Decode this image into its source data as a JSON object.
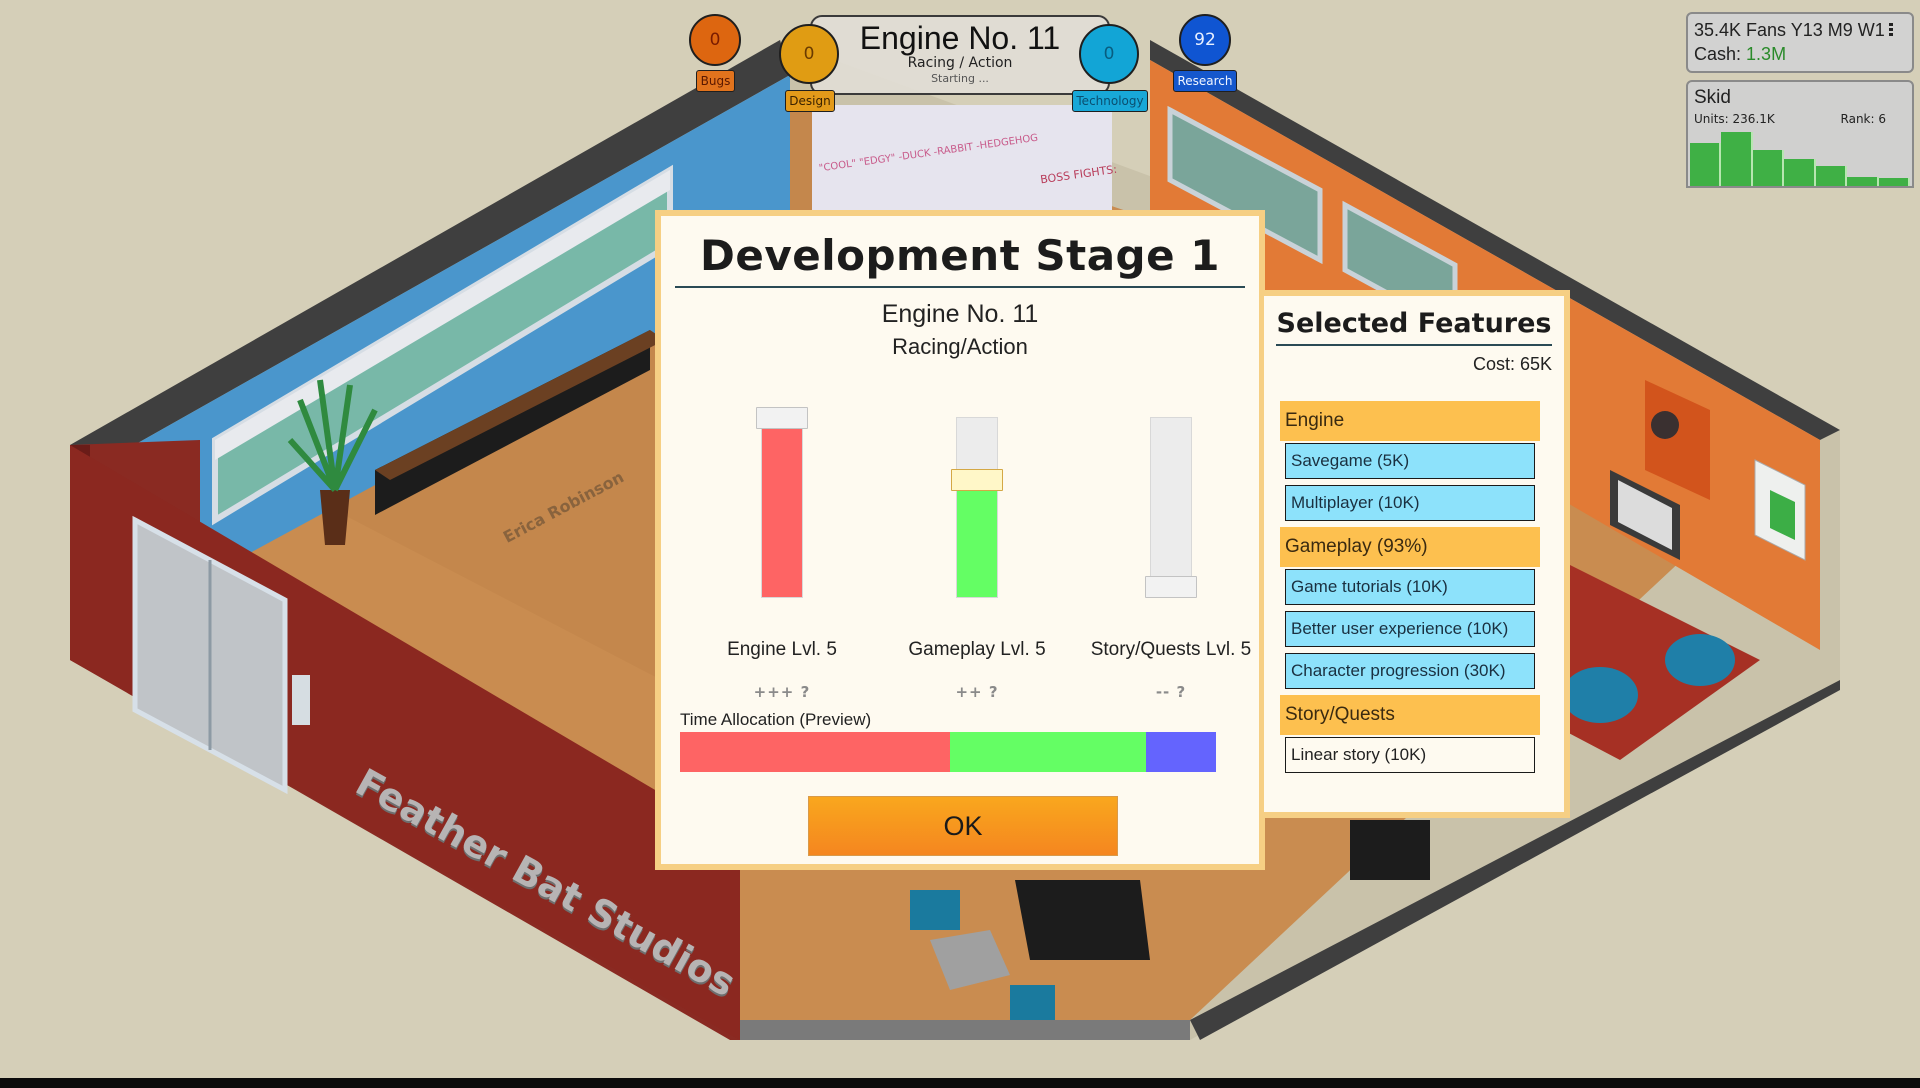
{
  "scene": {
    "studio_name": "Feather Bat Studios",
    "employee_name": "Erica Robinson",
    "whiteboard_left_note": "\"COOL\" \"EDGY\" -DUCK -RABBIT -HEDGEHOG",
    "whiteboard_right_note": "BOSS FIGHTS:"
  },
  "hud": {
    "bugs": {
      "value": "0",
      "label": "Bugs",
      "color": "#dd6610"
    },
    "design": {
      "value": "0",
      "label": "Design",
      "color": "#e09c13"
    },
    "technology": {
      "value": "0",
      "label": "Technology",
      "color": "#12a5d6"
    },
    "research": {
      "value": "92",
      "label": "Research",
      "color": "#0f55d2"
    },
    "game": {
      "name": "Engine No. 11",
      "genre": "Racing / Action",
      "status": "Starting ..."
    }
  },
  "stats": {
    "fans": "35.4K Fans",
    "date": "Y13 M9 W1",
    "cash_label": "Cash:",
    "cash_value": "1.3M",
    "cash_color": "#2a8a2a"
  },
  "sales": {
    "title": "Skid",
    "units_label": "Units: 236.1K",
    "rank_label": "Rank: 6",
    "bar_color": "#3fb045",
    "weekly_relative": [
      0.79,
      1.0,
      0.67,
      0.5,
      0.37,
      0.17,
      0.15
    ]
  },
  "dialog": {
    "title": "Development Stage 1",
    "game_name": "Engine No. 11",
    "genre": "Racing/Action",
    "sliders": [
      {
        "id": "engine",
        "label": "Engine Lvl. 5",
        "rating": "+++ ?",
        "level": 1.0,
        "color": "#fe6464"
      },
      {
        "id": "gameplay",
        "label": "Gameplay Lvl. 5",
        "rating": "++ ?",
        "level": 0.67,
        "color": "#64fe64"
      },
      {
        "id": "story",
        "label": "Story/Quests Lvl. 5",
        "rating": "-- ?",
        "level": 0.0,
        "color": "#6464fe"
      }
    ],
    "time_allocation": {
      "label": "Time Allocation (Preview)",
      "segments": [
        {
          "name": "Engine",
          "fraction": 0.504,
          "color": "#fe6464"
        },
        {
          "name": "Gameplay",
          "fraction": 0.366,
          "color": "#64fe64"
        },
        {
          "name": "Story/Quests",
          "fraction": 0.13,
          "color": "#6464fe"
        }
      ]
    },
    "ok_label": "OK"
  },
  "features": {
    "title": "Selected Features",
    "cost": "Cost: 65K",
    "categories": [
      {
        "name": "Engine",
        "items": [
          {
            "label": "Savegame (5K)",
            "selected": true
          },
          {
            "label": "Multiplayer (10K)",
            "selected": true
          }
        ]
      },
      {
        "name": "Gameplay (93%)",
        "items": [
          {
            "label": "Game tutorials (10K)",
            "selected": true
          },
          {
            "label": "Better user experience (10K)",
            "selected": true
          },
          {
            "label": "Character progression (30K)",
            "selected": true
          }
        ]
      },
      {
        "name": "Story/Quests",
        "items": [
          {
            "label": "Linear story (10K)",
            "selected": false
          }
        ]
      }
    ]
  }
}
